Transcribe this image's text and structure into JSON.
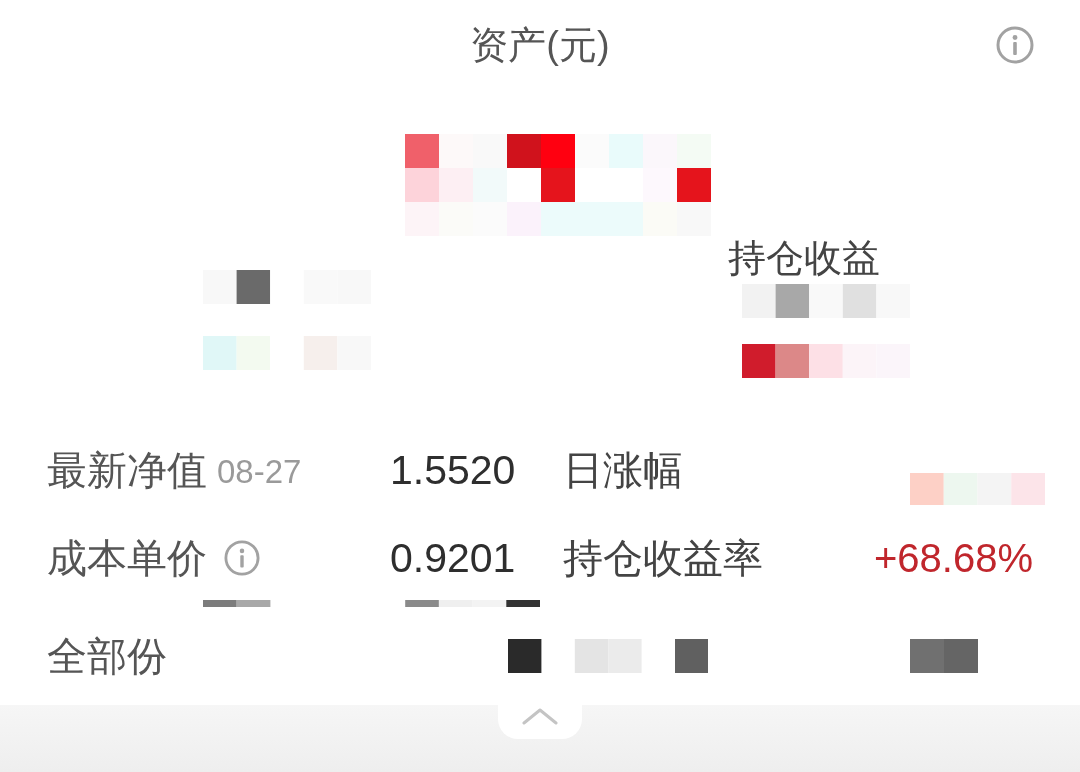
{
  "header": {
    "title": "资产(元)"
  },
  "summary": {
    "label": "持仓收益"
  },
  "rows": [
    {
      "label": "最新净值",
      "date": "08-27",
      "value": "1.5520",
      "label_2": "日涨幅"
    },
    {
      "label": "成本单价",
      "info_icon": true,
      "value": "0.9201",
      "label_2": "持仓收益率",
      "value_2": "+68.68%",
      "rising": true
    },
    {
      "label": "全部份"
    }
  ]
}
